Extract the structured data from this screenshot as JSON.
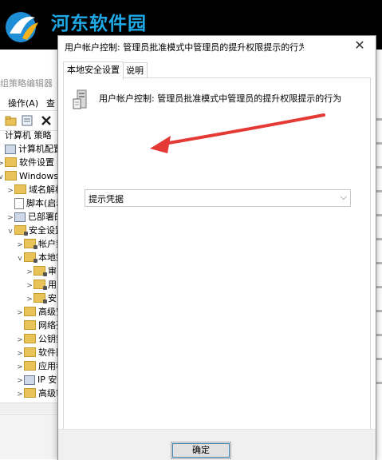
{
  "watermark": {
    "site_name": "河东软件园"
  },
  "background_window": {
    "title": "组策略编辑器",
    "menu": {
      "action": "操作(A)",
      "view": "查"
    },
    "tree": [
      {
        "label": "计算机 策略",
        "indent": 0,
        "icon": "none-icon",
        "chevron": ""
      },
      {
        "label": "计算机配置",
        "indent": 0,
        "icon": "pc-icon",
        "chevron": ""
      },
      {
        "label": "软件设置",
        "indent": 0,
        "icon": "folder-icon",
        "chevron": ">"
      },
      {
        "label": "Windows 设",
        "indent": 0,
        "icon": "folder-icon",
        "chevron": "v"
      },
      {
        "label": "域名解析",
        "indent": 1,
        "icon": "folder-icon",
        "chevron": ">"
      },
      {
        "label": "脚本(启动",
        "indent": 1,
        "icon": "doc-icon",
        "chevron": ""
      },
      {
        "label": "已部署的",
        "indent": 1,
        "icon": "pc-icon",
        "chevron": ">"
      },
      {
        "label": "安全设置",
        "indent": 1,
        "icon": "folder-lock-icon",
        "chevron": "v"
      },
      {
        "label": "帐户策",
        "indent": 2,
        "icon": "folder-lock-icon",
        "chevron": ">"
      },
      {
        "label": "本地策",
        "indent": 2,
        "icon": "folder-lock-icon",
        "chevron": "v"
      },
      {
        "label": "审",
        "indent": 3,
        "icon": "folder-lock-icon",
        "chevron": ">"
      },
      {
        "label": "用",
        "indent": 3,
        "icon": "folder-lock-icon",
        "chevron": ">"
      },
      {
        "label": "安",
        "indent": 3,
        "icon": "folder-lock-icon",
        "chevron": ">"
      },
      {
        "label": "高级安",
        "indent": 2,
        "icon": "folder-icon",
        "chevron": ">"
      },
      {
        "label": "网络列",
        "indent": 2,
        "icon": "folder-icon",
        "chevron": ""
      },
      {
        "label": "公钥策",
        "indent": 2,
        "icon": "folder-icon",
        "chevron": ">"
      },
      {
        "label": "软件限",
        "indent": 2,
        "icon": "folder-icon",
        "chevron": ">"
      },
      {
        "label": "应用程",
        "indent": 2,
        "icon": "folder-icon",
        "chevron": ">"
      },
      {
        "label": "IP 安全",
        "indent": 2,
        "icon": "pc-icon",
        "chevron": ">"
      },
      {
        "label": "高级审",
        "indent": 2,
        "icon": "folder-icon",
        "chevron": ">"
      }
    ]
  },
  "dialog": {
    "title": "用户帐户控制: 管理员批准模式中管理员的提升权限提示的行为 属性",
    "close_glyph": "✕",
    "tabs": [
      {
        "label": "本地安全设置",
        "active": true
      },
      {
        "label": "说明",
        "active": false
      }
    ],
    "policy_name": "用户帐户控制: 管理员批准模式中管理员的提升权限提示的行为",
    "select": {
      "value": "提示凭据",
      "chevron": "⌵"
    },
    "ok_label": "确定",
    "annotation_color": "#e53935"
  }
}
